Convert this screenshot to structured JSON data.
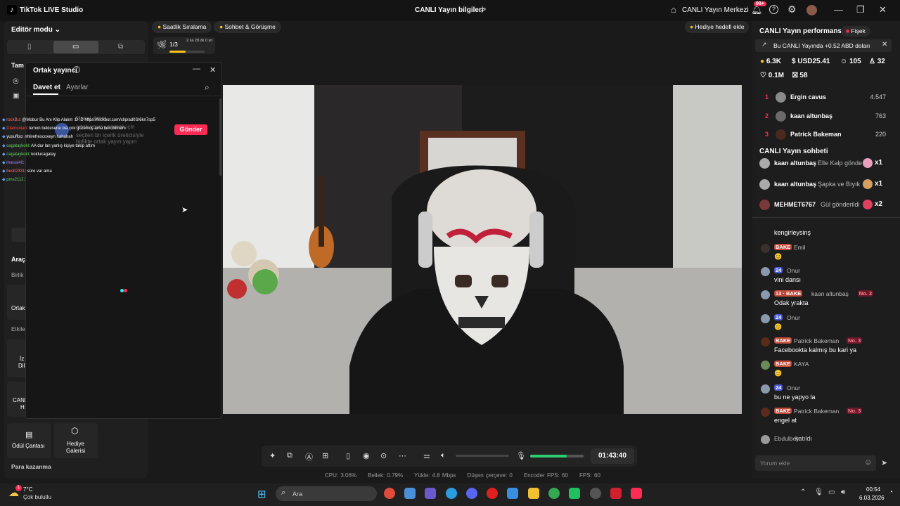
{
  "titlebar": {
    "app_title": "TikTok LIVE Studio",
    "center_title": "CANLI Yayın bilgileri",
    "canli_merkezi": "CANLI Yayın Merkezi",
    "notif_badge": "99+"
  },
  "left": {
    "editor_mode": "Editör modu ⌄",
    "tam_label": "Tam",
    "araclar": "Araç",
    "birlik": "Birlik",
    "ortak_label": "Ortak",
    "etkile": "Etkile",
    "izi_dili": [
      "İz",
      "Dili"
    ],
    "canli_h": [
      "CANL",
      "H"
    ],
    "odul_cantasi": "Ödül Çantası",
    "hediye_galerisi": [
      "Hediye",
      "Galerisi"
    ],
    "para_kazanma": "Para kazanma"
  },
  "ortak": {
    "title": "Ortak yayıncı",
    "tab_davet": "Davet et",
    "tab_ayarlar": "Ayarlar",
    "gonder": "Gönder",
    "faded_lines": [
      "Mesaj davet",
      "ortak yayın yapmak için",
      "seçilen bir içerik üreticisiyle",
      "birlikte ortak yayın yapın"
    ]
  },
  "overlay_chat": [
    {
      "user": "rockBu",
      "msg": ": @Mobur Bu Anı Klip Alalım :D :D https://kickbot.com/clip/ad0SI6kn7sp5",
      "color": "#ff6b6b"
    },
    {
      "user": "Diamonian",
      "msg": ": lemon beklesene ola çok güzelmiş ama ben bilmem",
      "color": "#ff4444"
    },
    {
      "user": "yusuffoo",
      "msg": ": nhlirefrescoxeyn hahahah",
      "color": "#ffffff"
    },
    {
      "user": "cagataykokl",
      "msg": ": AA dur lan yanlış kişiye takip attım",
      "color": "#5fd35f"
    },
    {
      "user": "cagataykokl",
      "msg": ": koklucagatay",
      "color": "#5fd35f"
    },
    {
      "user": "lmessi40",
      "msg": ":",
      "color": "#b07cff"
    },
    {
      "user": "besit2331",
      "msg": ": süre var ama",
      "color": "#ff6b6b"
    },
    {
      "user": "pms2112",
      "msg": ":",
      "color": "#5fd35f"
    }
  ],
  "chips": {
    "saatlik": "Saatlik Sıralama",
    "sohbet": "Sohbet & Görüşme",
    "hediye_hedefi": "Hediye hedefi ekle"
  },
  "goal": {
    "count": "1/3",
    "time": "2 sa 28 dk 0 sn",
    "progress": 0.45
  },
  "controls": {
    "dusen_cerceve": "Düşen çerçeve:",
    "timer": "01:43:40",
    "volume": 0.68
  },
  "stats_bar": {
    "cpu": "CPU: 3.06%",
    "bellek": "Bellek: 0.79%",
    "yukle": "Yükle: 4.8 Mbps",
    "dusen": "Düşen çerçeve: 0",
    "encoder_fps": "Encoder FPS: 60",
    "fps": "FPS: 60"
  },
  "right": {
    "perf_title": "CANLI Yayın performansı",
    "fisek": "Fişek",
    "bonus": "Bu CANLI Yayında +0.52 ABD doları",
    "stats": {
      "coins": "6.3K",
      "usd": "USD25.41",
      "viewers": "105",
      "new_followers": "32",
      "likes": "0.1M",
      "gifters": "58"
    },
    "ranking": [
      {
        "rank": "1",
        "name": "Ergin cavus",
        "value": "4.547"
      },
      {
        "rank": "2",
        "name": "kaan altunbaş",
        "value": "763"
      },
      {
        "rank": "3",
        "name": "Patrick Bakeman",
        "value": "220"
      }
    ],
    "sohbet_title": "CANLI Yayın sohbeti",
    "gift_events": [
      {
        "name": "kaan altunbaş",
        "text": "Elle Kalp gönde",
        "mult": "x1"
      },
      {
        "name": "kaan altunbaş",
        "text": "Şapka ve Bıyık",
        "mult": "x1"
      },
      {
        "name": "MEHMET6767",
        "text": "Gül gönderildi",
        "mult": "x2"
      }
    ],
    "chat": [
      {
        "badges": "",
        "name": "",
        "msg": "kengirleysinş"
      },
      {
        "badges": "BAKE",
        "name": "Emil",
        "msg": "😊"
      },
      {
        "badges": "24",
        "name": "Onur",
        "msg": "vini dansı"
      },
      {
        "badges": "13 · BAKE",
        "name": "kaan altunbaş",
        "tag": "No. 2",
        "msg": "Odak yrakta"
      },
      {
        "badges": "24",
        "name": "Onur",
        "msg": "😊"
      },
      {
        "badges": "BAKE",
        "name": "Patrick Bakeman",
        "tag": "No. 3",
        "msg": "Facebookta kalmış bu kari ya"
      },
      {
        "badges": "BAKE",
        "name": "KAYA",
        "msg": "😊"
      },
      {
        "badges": "24",
        "name": "Onur",
        "msg": "bu ne yapyo la"
      },
      {
        "badges": "BAKE",
        "name": "Patrick Bakeman",
        "tag": "No. 3",
        "msg": "engel at"
      },
      {
        "badges": "",
        "name": "Ebdulbey",
        "msg": "katıldı"
      }
    ],
    "yorum_placeholder": "Yorum ekle"
  },
  "taskbar": {
    "temp": "7°C",
    "weather": "Çok bulutlu",
    "search": "Ara",
    "time": "00:54",
    "date": "6.03.2026",
    "weather_badge": "1"
  }
}
